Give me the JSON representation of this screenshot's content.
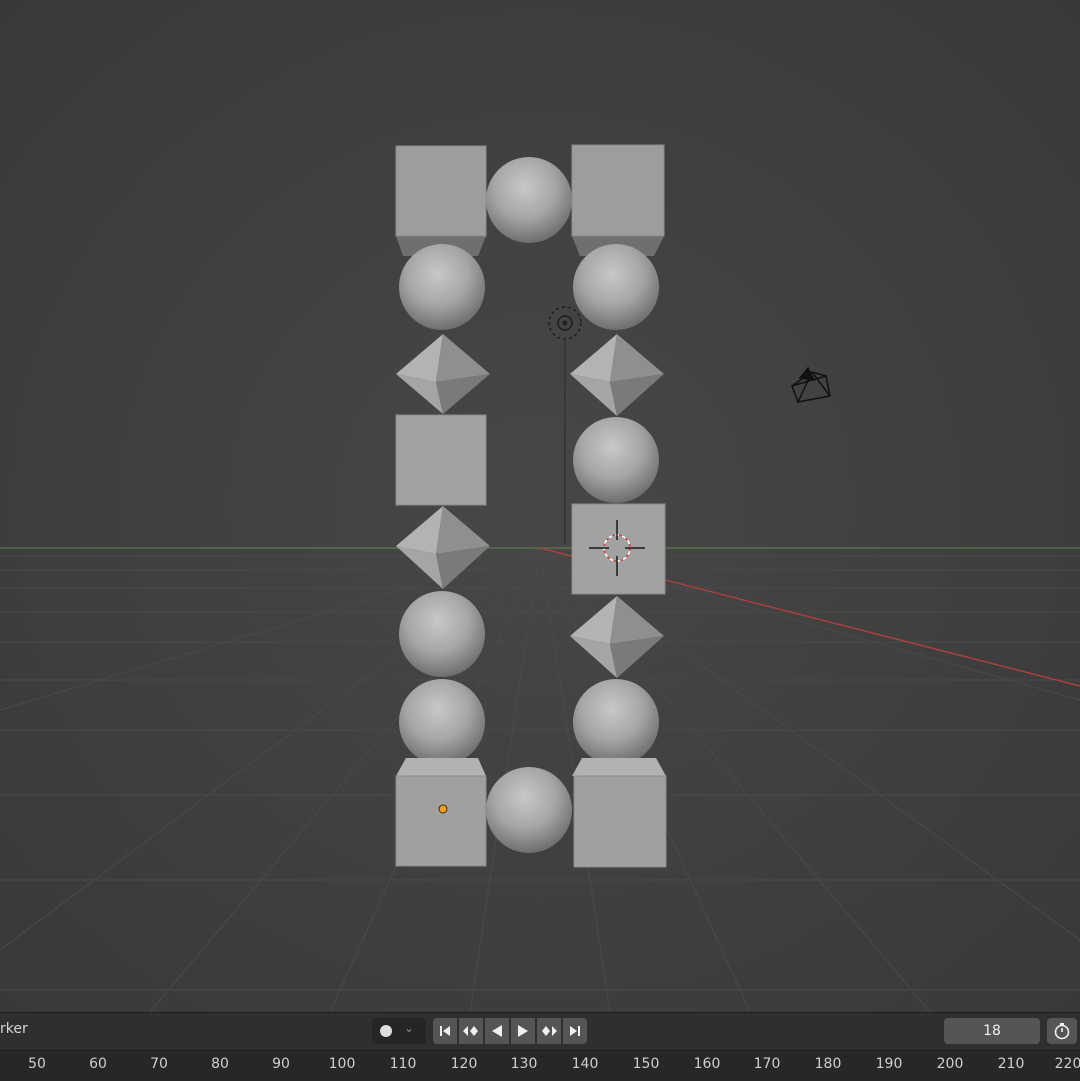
{
  "timeline": {
    "menu_marker": "rker",
    "keying_icon": "record-dot-icon",
    "transport_icons": [
      "jump-start-icon",
      "prev-keyframe-icon",
      "play-reverse-icon",
      "play-icon",
      "next-keyframe-icon",
      "jump-end-icon"
    ],
    "current_frame": "18",
    "ruler_ticks": [
      "50",
      "60",
      "70",
      "80",
      "90",
      "100",
      "110",
      "120",
      "130",
      "140",
      "150",
      "160",
      "170",
      "180",
      "190",
      "200",
      "210",
      "220"
    ]
  },
  "viewport": {
    "objects": {
      "left_column": [
        "cube",
        "sphere",
        "octahedron",
        "cube",
        "octahedron",
        "sphere",
        "sphere",
        "cube"
      ],
      "right_column": [
        "cube",
        "sphere",
        "octahedron",
        "sphere",
        "cube",
        "octahedron",
        "sphere",
        "cube"
      ],
      "middle": [
        "sphere",
        "sphere"
      ]
    },
    "scene_icons": [
      "light-icon",
      "camera-icon",
      "3d-cursor-icon",
      "origin-dot-icon"
    ],
    "colors": {
      "background": "#3d3d3d",
      "object_fill": "#9b9b9b",
      "x_axis": "#b04040",
      "y_axis": "#6a8a4a",
      "origin": "#f0a020"
    }
  }
}
